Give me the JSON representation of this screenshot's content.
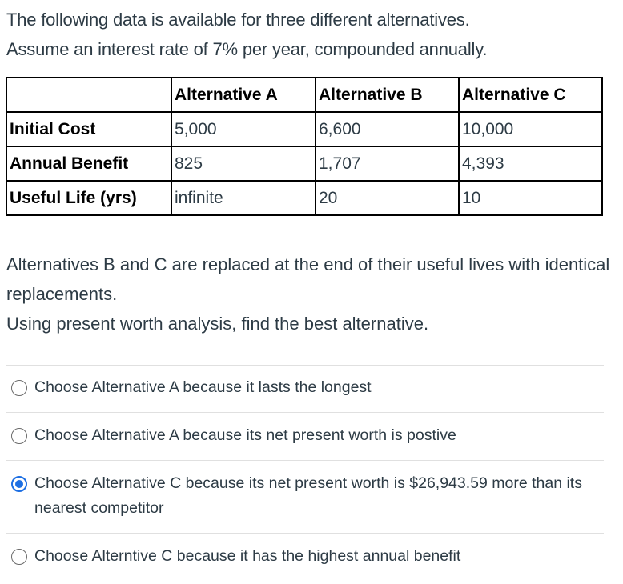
{
  "question": {
    "intro": [
      "The following data is available for three different alternatives.",
      "Assume an interest rate of 7% per year, compounded annually."
    ],
    "table": {
      "columns": [
        "",
        "Alternative A",
        "Alternative B",
        "Alternative C"
      ],
      "rows": [
        {
          "label": "Initial Cost",
          "values": [
            "5,000",
            "6,600",
            "10,000"
          ]
        },
        {
          "label": "Annual Benefit",
          "values": [
            "825",
            "1,707",
            "4,393"
          ]
        },
        {
          "label": "Useful Life (yrs)",
          "values": [
            "infinite",
            "20",
            "10"
          ]
        }
      ]
    },
    "after": [
      "Alternatives B and C are replaced at the end of their useful lives with identical replacements.",
      "Using present worth analysis, find the best alternative."
    ]
  },
  "answers": [
    {
      "label": "Choose Alternative A because it lasts the longest",
      "selected": false
    },
    {
      "label": "Choose Alternative A because its net present worth is postive",
      "selected": false
    },
    {
      "label": "Choose Alternative C because its net present worth is $26,943.59 more than its nearest competitor",
      "selected": true
    },
    {
      "label": "Choose Alterntive C because it has the highest annual benefit",
      "selected": false
    }
  ],
  "colors": {
    "text": "#2d3b45",
    "selected_radio": "#1d6fe3",
    "divider": "#e0e0e0"
  }
}
